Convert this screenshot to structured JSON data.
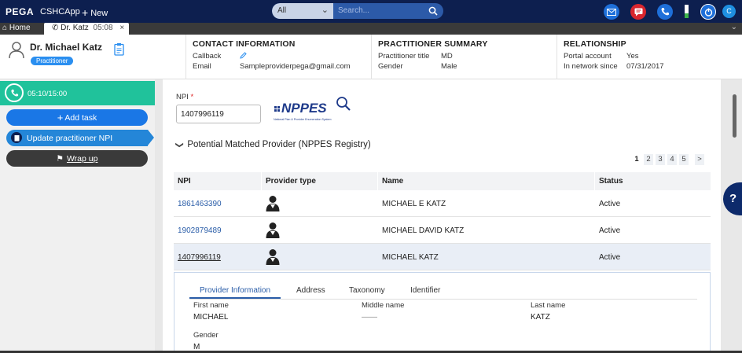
{
  "topbar": {
    "brand": "PEGA",
    "app_name": "CSHCApp",
    "new_label": "New",
    "search_scope": "All",
    "search_placeholder": "Search...",
    "avatar_initial": "C"
  },
  "tabs": {
    "home_label": "Home",
    "active_tab_label": "Dr. Katz",
    "active_tab_time": "05:08"
  },
  "header": {
    "name": "Dr. Michael Katz",
    "badge": "Practitioner",
    "contact": {
      "title": "CONTACT INFORMATION",
      "callback_label": "Callback",
      "email_label": "Email",
      "email_value": "Sampleproviderpega@gmail.com"
    },
    "summary": {
      "title": "PRACTITIONER SUMMARY",
      "title_label": "Practitioner title",
      "title_value": "MD",
      "gender_label": "Gender",
      "gender_value": "Male"
    },
    "relationship": {
      "title": "RELATIONSHIP",
      "portal_label": "Portal account",
      "portal_value": "Yes",
      "network_label": "In network since",
      "network_value": "07/31/2017"
    }
  },
  "left_panel": {
    "call_timer": "05:10/15:00",
    "add_task": "Add task",
    "update_npi": "Update practitioner NPI",
    "wrap_up": "Wrap up"
  },
  "main": {
    "npi_label": "NPI",
    "npi_required": "*",
    "npi_value": "1407996119",
    "nppes_logo_text": "NPPES",
    "nppes_logo_sub": "National Plan & Provider Enumeration System",
    "section_title": "Potential Matched Provider (NPPES Registry)",
    "pages": [
      "1",
      "2",
      "3",
      "4",
      "5",
      ">"
    ],
    "columns": [
      "NPI",
      "Provider type",
      "Name",
      "Status"
    ],
    "rows": [
      {
        "npi": "1861463390",
        "name": "MICHAEL E KATZ",
        "status": "Active"
      },
      {
        "npi": "1902879489",
        "name": "MICHAEL DAVID KATZ",
        "status": "Active"
      },
      {
        "npi": "1407996119",
        "name": "MICHAEL KATZ",
        "status": "Active"
      }
    ],
    "detail": {
      "tabs": [
        "Provider Information",
        "Address",
        "Taxonomy",
        "Identifier"
      ],
      "first_name_label": "First name",
      "first_name_value": "MICHAEL",
      "middle_name_label": "Middle name",
      "middle_name_value": "——",
      "last_name_label": "Last name",
      "last_name_value": "KATZ",
      "gender_label": "Gender",
      "gender_value": "M"
    }
  },
  "help_label": "?",
  "colors": {
    "topbar": "#0d1f4f",
    "call_green": "#20c29b",
    "primary_blue": "#1a77e6",
    "link_blue": "#2a5da8"
  },
  "icons": [
    "menu-icon",
    "search-icon",
    "email-icon",
    "chat-icon",
    "phone-icon",
    "presence-icon",
    "home-icon",
    "phone-tab-icon",
    "person-icon",
    "clipboard-icon",
    "edit-icon",
    "call-icon",
    "flag-icon",
    "doctor-icon",
    "magnifier-icon"
  ]
}
